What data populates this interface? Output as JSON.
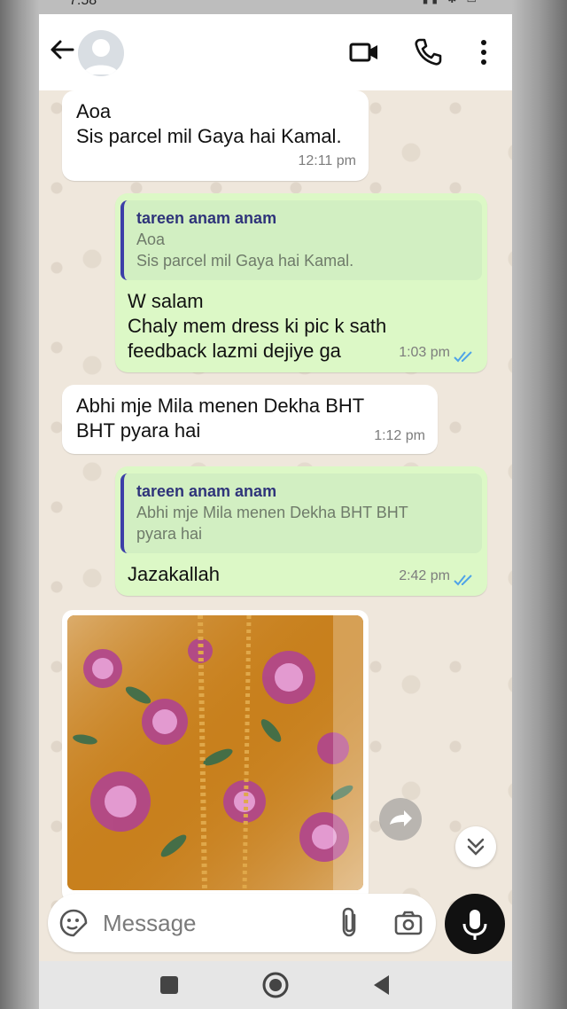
{
  "status_bar": {
    "time": "7:58",
    "icons": "▮▮ ✱ ▭"
  },
  "chat_header": {
    "avatar": "default-profile",
    "actions": [
      "video-call-icon",
      "voice-call-icon",
      "more-options-icon"
    ]
  },
  "messages": [
    {
      "direction": "incoming",
      "text": "Aoa\nSis parcel mil Gaya hai Kamal.",
      "time": "12:11 pm"
    },
    {
      "direction": "outgoing",
      "quote": {
        "author": "tareen anam anam",
        "text": "Aoa\nSis parcel mil Gaya hai Kamal."
      },
      "text": "W salam\nChaly mem dress ki pic k sath\nfeedback lazmi dejiye ga",
      "time": "1:03 pm",
      "status": "read"
    },
    {
      "direction": "incoming",
      "text": "Abhi mje Mila menen Dekha BHT\nBHT pyara hai",
      "time": "1:12 pm"
    },
    {
      "direction": "outgoing",
      "quote": {
        "author": "tareen anam anam",
        "text": "Abhi mje Mila menen Dekha BHT BHT\npyara hai"
      },
      "text": "Jazakallah",
      "time": "2:42 pm",
      "status": "read"
    },
    {
      "direction": "incoming",
      "type": "image",
      "description": "orange floral printed dress fabric"
    }
  ],
  "composer": {
    "placeholder": "Message"
  },
  "colors": {
    "incoming_bubble": "#ffffff",
    "outgoing_bubble": "#dcf8c6",
    "read_ticks": "#4fa3e8",
    "quote_bar": "#3c3fa8",
    "quote_author": "#2f347a"
  }
}
